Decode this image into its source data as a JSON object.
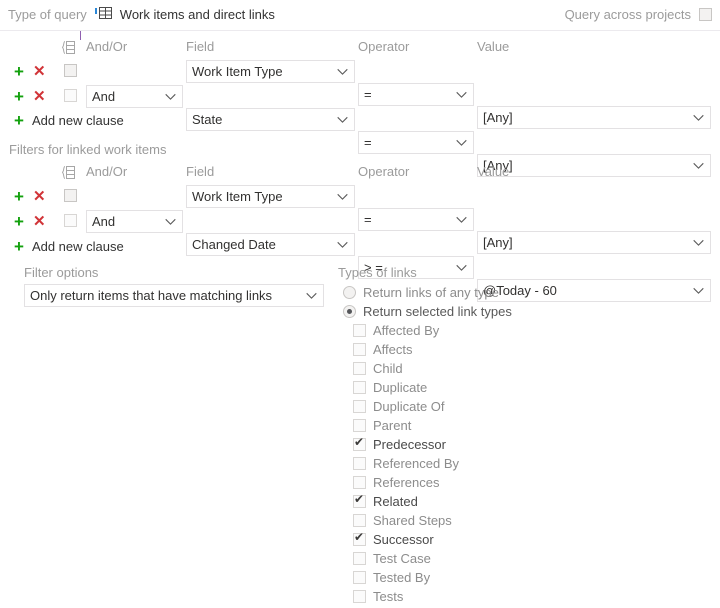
{
  "topbar": {
    "type_of_query_label": "Type of query",
    "query_type_icon": "grid-table-icon",
    "query_type_value": "Work items and direct links",
    "query_across_projects_label": "Query across projects",
    "query_across_projects_checked": false
  },
  "colors": {
    "add_green": "#13a10e",
    "remove_red": "#d13438",
    "muted_text": "#9b9b9b",
    "body_text": "#333333",
    "divider": "#eceaee",
    "field_border": "#e3e1e3"
  },
  "columns": {
    "group": "group-clauses-icon",
    "andor": "And/Or",
    "field": "Field",
    "operator": "Operator",
    "value": "Value"
  },
  "top_clauses": {
    "add_new_clause_label": "Add new clause",
    "rows": [
      {
        "add_icon": "plus-icon",
        "delete_icon": "close-icon",
        "checked": false,
        "andor": "",
        "andor_visible": false,
        "field": "Work Item Type",
        "operator": "=",
        "value": "[Any]"
      },
      {
        "add_icon": "plus-icon",
        "delete_icon": "close-icon",
        "checked": false,
        "andor": "And",
        "andor_visible": true,
        "field": "State",
        "operator": "=",
        "value": "[Any]"
      }
    ]
  },
  "linked_section": {
    "heading": "Filters for linked work items",
    "add_new_clause_label": "Add new clause",
    "rows": [
      {
        "add_icon": "plus-icon",
        "delete_icon": "close-icon",
        "checked": false,
        "andor": "",
        "andor_visible": false,
        "field": "Work Item Type",
        "operator": "=",
        "value": "[Any]"
      },
      {
        "add_icon": "plus-icon",
        "delete_icon": "close-icon",
        "checked": false,
        "andor": "And",
        "andor_visible": true,
        "field": "Changed Date",
        "operator": "> =",
        "value": "@Today - 60"
      }
    ]
  },
  "filter_options": {
    "label": "Filter options",
    "selected": "Only return items that have matching links"
  },
  "types_of_links": {
    "label": "Types of links",
    "radios": [
      {
        "label": "Return links of any type",
        "selected": false
      },
      {
        "label": "Return selected link types",
        "selected": true
      }
    ],
    "link_types": [
      {
        "label": "Affected By",
        "checked": false
      },
      {
        "label": "Affects",
        "checked": false
      },
      {
        "label": "Child",
        "checked": false
      },
      {
        "label": "Duplicate",
        "checked": false
      },
      {
        "label": "Duplicate Of",
        "checked": false
      },
      {
        "label": "Parent",
        "checked": false
      },
      {
        "label": "Predecessor",
        "checked": true
      },
      {
        "label": "Referenced By",
        "checked": false
      },
      {
        "label": "References",
        "checked": false
      },
      {
        "label": "Related",
        "checked": true
      },
      {
        "label": "Shared Steps",
        "checked": false
      },
      {
        "label": "Successor",
        "checked": true
      },
      {
        "label": "Test Case",
        "checked": false
      },
      {
        "label": "Tested By",
        "checked": false
      },
      {
        "label": "Tests",
        "checked": false
      }
    ]
  }
}
